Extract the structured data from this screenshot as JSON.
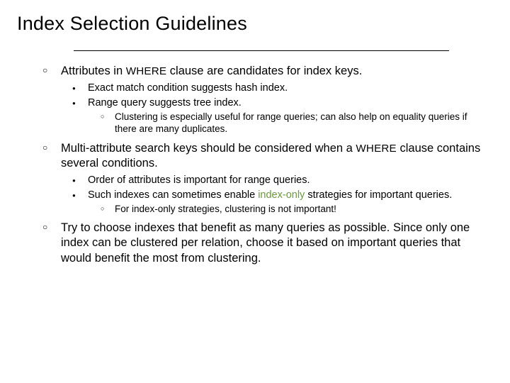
{
  "title": "Index Selection Guidelines",
  "b1": {
    "a_pre": "Attributes in ",
    "a_code": "WHERE",
    "a_post": " clause are candidates for index keys.",
    "s1": "Exact match condition suggests hash index.",
    "s2": "Range query suggests tree index.",
    "s2a": "Clustering is especially useful for range queries; can also help on equality queries if there are many duplicates."
  },
  "b2": {
    "a_pre": "Multi-attribute search keys should be considered when a ",
    "a_code": "WHERE",
    "a_post": " clause contains several conditions.",
    "s1": "Order of attributes is important for range queries.",
    "s2_pre": "Such indexes can sometimes enable ",
    "s2_hl": "index-only",
    "s2_post": " strategies for important queries.",
    "s2a": "For index-only strategies, clustering is not important!"
  },
  "b3": {
    "a": "Try to choose indexes that benefit as many queries as possible.  Since only one index can be clustered per relation, choose it based on important queries that would benefit the most from clustering."
  }
}
